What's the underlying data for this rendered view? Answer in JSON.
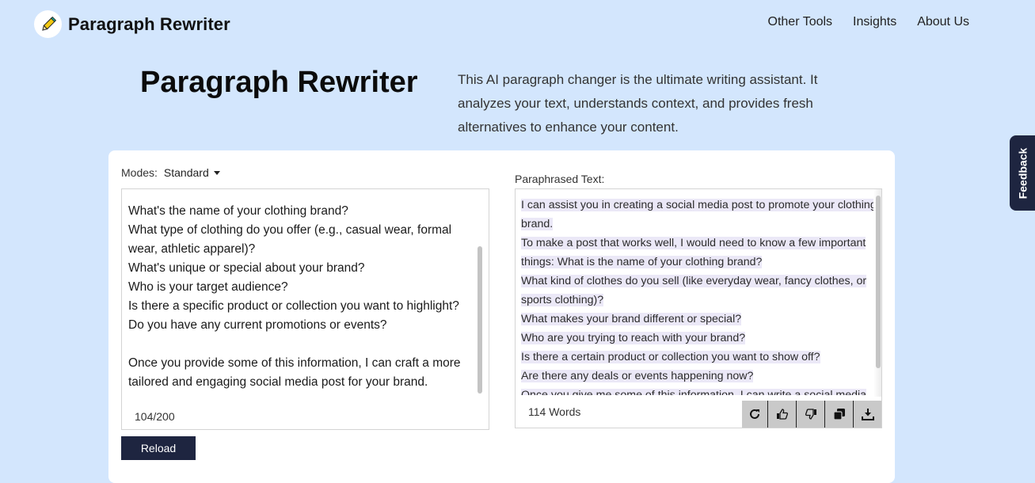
{
  "header": {
    "brand": "Paragraph Rewriter",
    "logo_icon": "pencil-icon",
    "nav": [
      {
        "label": "Other Tools"
      },
      {
        "label": "Insights"
      },
      {
        "label": "About Us"
      }
    ]
  },
  "hero": {
    "title": "Paragraph Rewriter",
    "description": "This AI paragraph changer is the ultimate writing assistant. It analyzes your text, understands context, and provides fresh alternatives to enhance your content."
  },
  "editor": {
    "modes_label": "Modes:",
    "mode_selected": "Standard",
    "input_text": "What's the name of your clothing brand?\nWhat type of clothing do you offer (e.g., casual wear, formal wear, athletic apparel)?\nWhat's unique or special about your brand?\nWho is your target audience?\nIs there a specific product or collection you want to highlight?\nDo you have any current promotions or events?\n\nOnce you provide some of this information, I can craft a more tailored and engaging social media post for your brand.",
    "char_count": "104/200",
    "reload_label": "Reload"
  },
  "output": {
    "label": "Paraphrased Text:",
    "sentences": [
      "I can assist you in creating a social media post to promote your clothing brand.",
      "To make a post that works well, I would need to know a few important things: What is the name of your clothing brand?",
      "What kind of clothes do you sell (like everyday wear, fancy clothes, or sports clothing)?",
      "What makes your brand different or special?",
      "Who are you trying to reach with your brand?",
      "Is there a certain product or collection you want to show off?",
      "Are there any deals or events happening now?",
      "Once you give me some of this information, I can write a social media"
    ],
    "word_count": "114 Words",
    "actions": [
      {
        "name": "regenerate",
        "icon": "refresh-icon"
      },
      {
        "name": "like",
        "icon": "thumbs-up-icon"
      },
      {
        "name": "dislike",
        "icon": "thumbs-down-icon"
      },
      {
        "name": "copy",
        "icon": "copy-icon"
      },
      {
        "name": "download",
        "icon": "download-icon"
      }
    ]
  },
  "feedback": {
    "label": "Feedback"
  },
  "colors": {
    "page_bg": "#d3e6fd",
    "dark_navy": "#1e2540",
    "highlight": "#ebe8f7",
    "action_bg": "#c9c9c9"
  }
}
